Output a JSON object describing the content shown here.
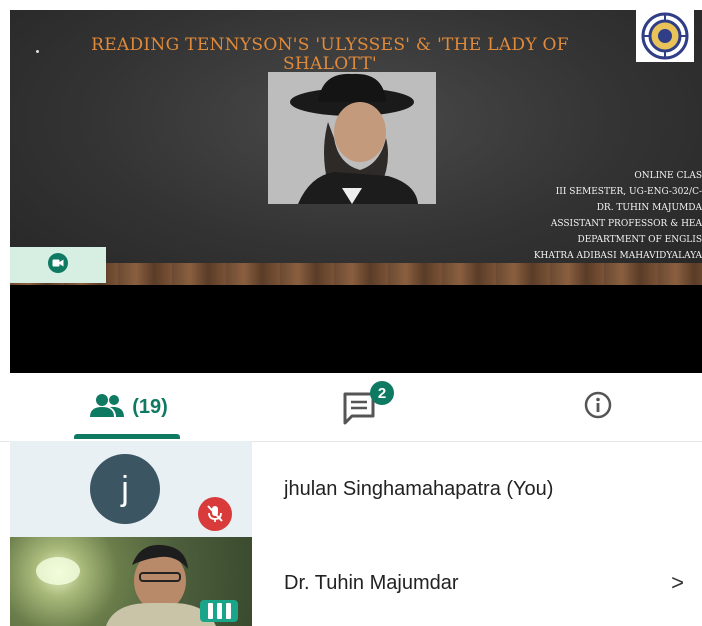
{
  "slide": {
    "title": "READING TENNYSON'S 'ULYSSES' & 'THE LADY OF SHALOTT'",
    "credits": [
      "ONLINE CLAS",
      "III SEMESTER, UG-ENG-302/C-",
      "DR. TUHIN MAJUMDA",
      "ASSISTANT PROFESSOR & HEA",
      "DEPARTMENT OF ENGLIS",
      "KHATRA ADIBASI MAHAVIDYALAYA"
    ]
  },
  "tabs": {
    "people_count": "(19)",
    "chat_badge": "2"
  },
  "participants": [
    {
      "initial": "j",
      "name": "jhulan Singhamahapatra (You)"
    },
    {
      "name": "Dr. Tuhin Majumdar",
      "chevron": ">"
    }
  ],
  "colors": {
    "accent": "#0f7a62",
    "mic_off": "#d93a3a",
    "slide_title": "#e08a3a"
  },
  "icons": [
    "video-camera-icon",
    "people-icon",
    "chat-icon",
    "info-icon",
    "mic-off-icon",
    "speaking-indicator-icon",
    "chevron-right-icon"
  ]
}
